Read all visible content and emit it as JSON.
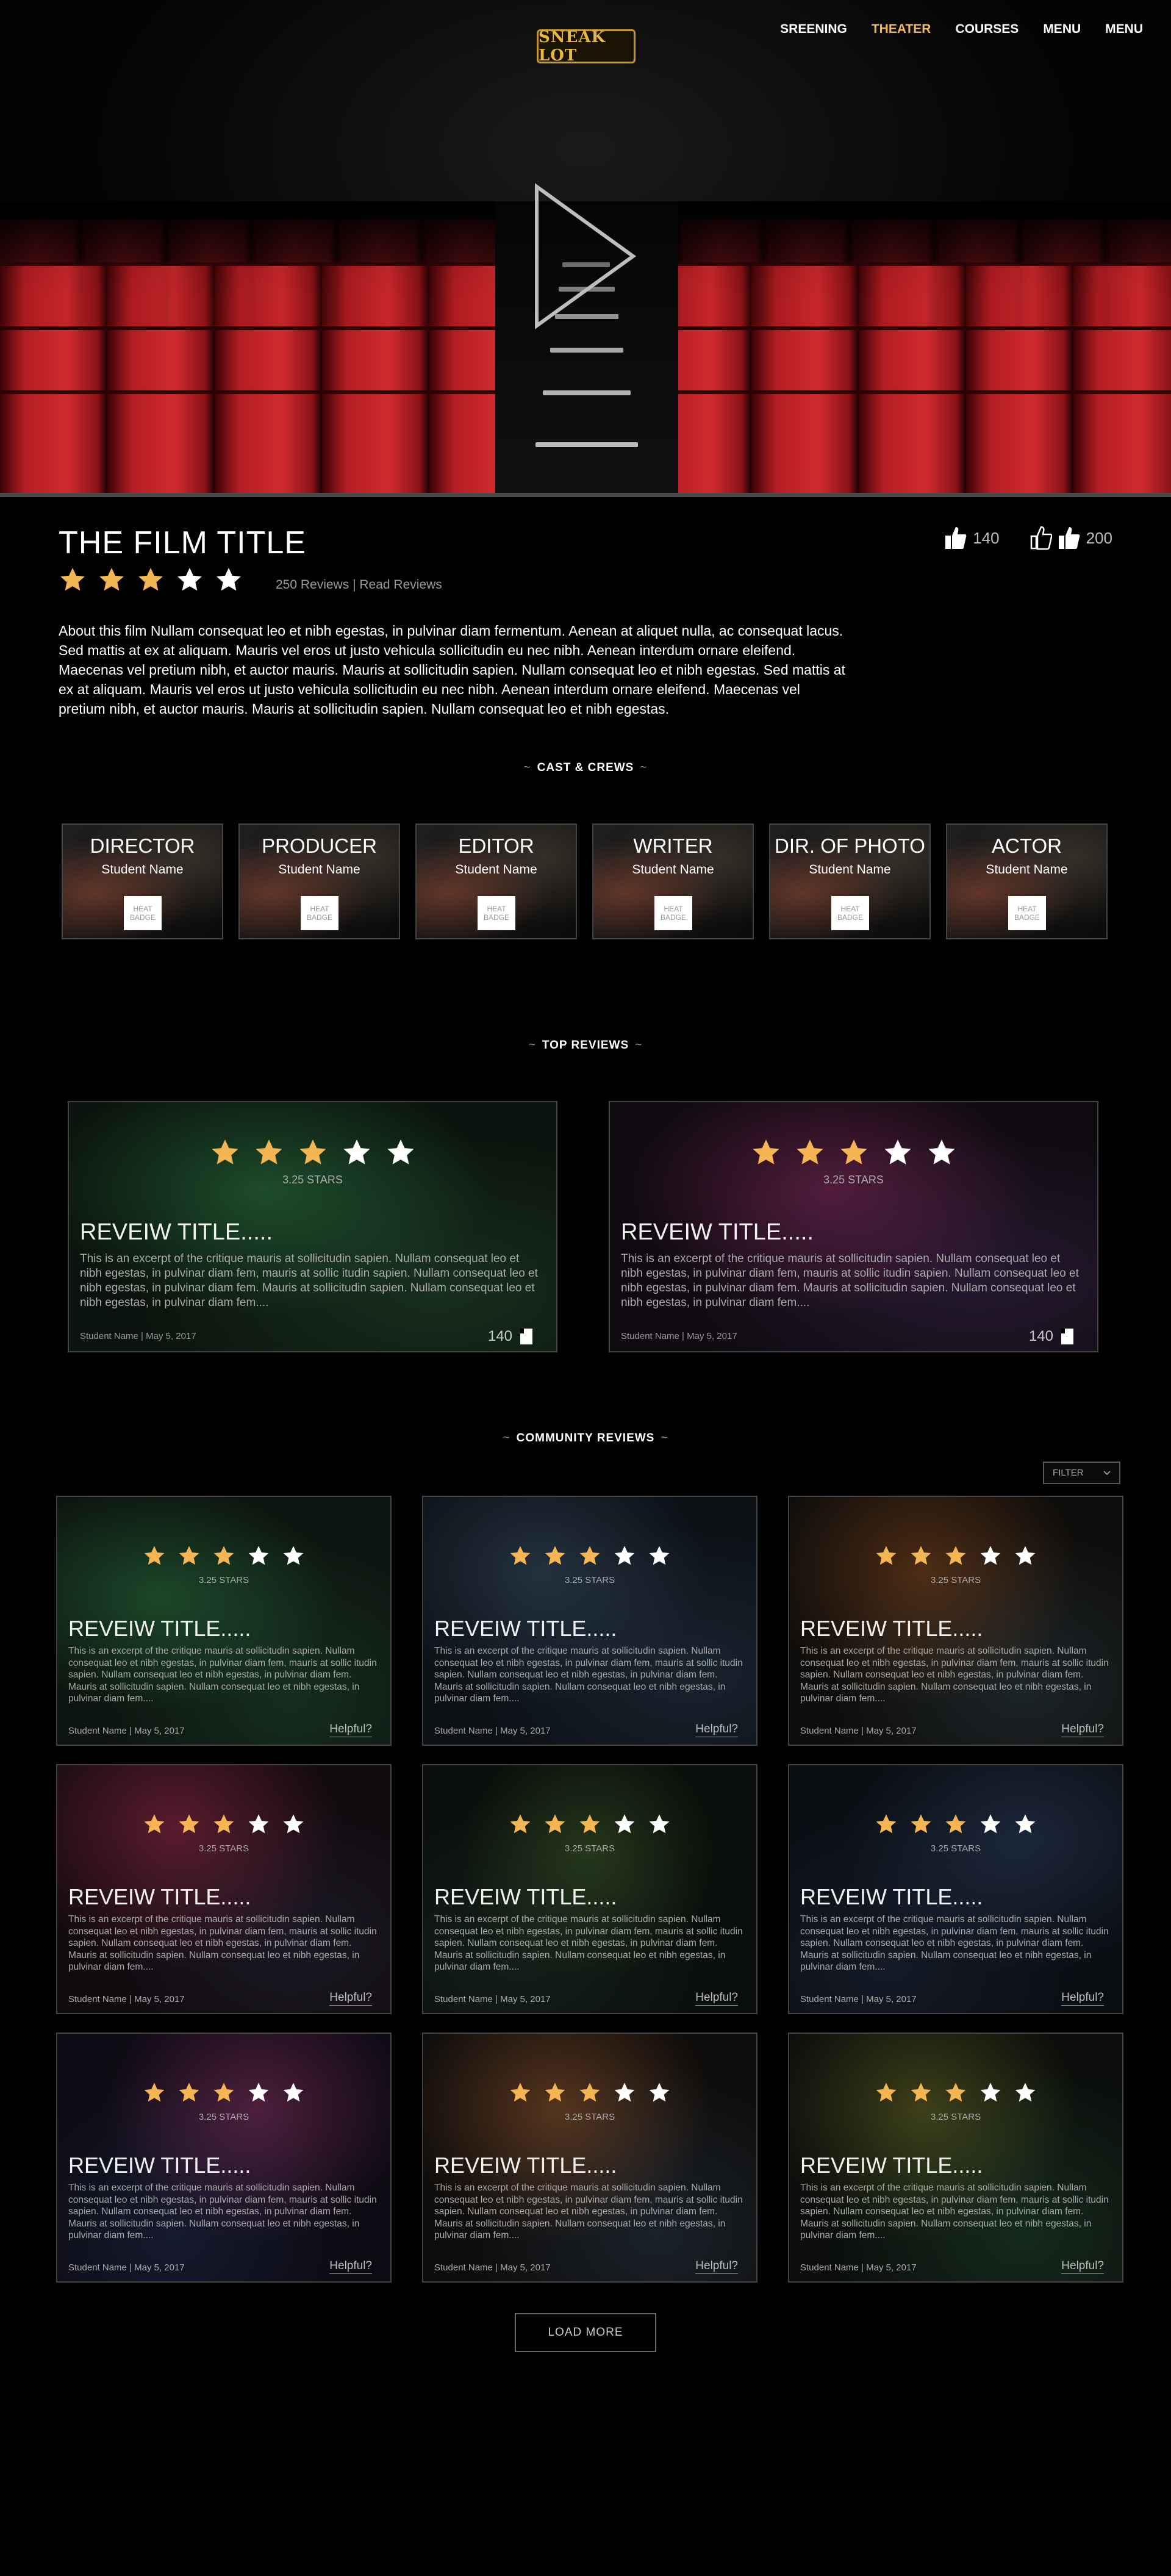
{
  "header": {
    "logo_text": "SNEAK LOT",
    "nav": [
      {
        "label": "SREENING",
        "active": false
      },
      {
        "label": "THEATER",
        "active": true
      },
      {
        "label": "COURSES",
        "active": false
      },
      {
        "label": "MENU",
        "active": false
      },
      {
        "label": "MENU",
        "active": false
      }
    ]
  },
  "hero": {
    "play_icon": "play-icon"
  },
  "film": {
    "title": "THE FILM TITLE",
    "rating": 3,
    "max_rating": 5,
    "reviews_link": "250 Reviews",
    "separator": "|",
    "read_reviews_link": "Read Reviews",
    "likes": "140",
    "dislikes": "200",
    "about": "About this film Nullam consequat leo et nibh egestas, in pulvinar diam fermentum. Aenean at aliquet nulla, ac consequat lacus. Sed mattis at ex at aliquam. Mauris vel eros ut justo vehicula sollicitudin eu nec nibh. Aenean interdum ornare eleifend. Maecenas vel pretium nibh, et auctor mauris. Mauris at sollicitudin sapien. Nullam consequat leo et nibh egestas. Sed mattis at ex at aliquam. Mauris vel eros ut justo vehicula sollicitudin eu nec nibh. Aenean interdum ornare eleifend. Maecenas vel pretium nibh, et auctor mauris. Mauris at sollicitudin sapien. Nullam consequat leo et nibh egestas."
  },
  "sections": {
    "cast": "CAST & CREWS",
    "top_reviews": "TOP  REVIEWS",
    "community_reviews": "COMMUNITY REVIEWS",
    "tilde": "~"
  },
  "cast": [
    {
      "role": "DIRECTOR",
      "name": "Student Name",
      "badge": "HEAT BADGE"
    },
    {
      "role": "PRODUCER",
      "name": "Student Name",
      "badge": "HEAT BADGE"
    },
    {
      "role": "EDITOR",
      "name": "Student Name",
      "badge": "HEAT BADGE"
    },
    {
      "role": "WRITER",
      "name": "Student Name",
      "badge": "HEAT BADGE"
    },
    {
      "role": "DIR. OF PHOTO",
      "name": "Student Name",
      "badge": "HEAT BADGE"
    },
    {
      "role": "ACTOR",
      "name": "Student Name",
      "badge": "HEAT BADGE"
    }
  ],
  "top_reviews": [
    {
      "rating": 3,
      "stars_label": "3.25 STARS",
      "title": "REVEIW TITLE.....",
      "excerpt": "This is an excerpt of the critique mauris at sollicitudin sapien. Nullam consequat leo et nibh egestas, in pulvinar diam fem, mauris at sollic itudin sapien. Nullam consequat leo et nibh egestas, in pulvinar diam fem. Mauris at sollicitudin sapien. Nullam consequat leo et nibh egestas, in pulvinar diam fem....",
      "meta": "Student Name | May 5, 2017",
      "count": "140"
    },
    {
      "rating": 3,
      "stars_label": "3.25 STARS",
      "title": "REVEIW TITLE.....",
      "excerpt": "This is an excerpt of the critique mauris at sollicitudin sapien. Nullam consequat leo et nibh egestas, in pulvinar diam fem, mauris at sollic itudin sapien. Nullam consequat leo et nibh egestas, in pulvinar diam fem. Mauris at sollicitudin sapien. Nullam consequat leo et nibh egestas, in pulvinar diam fem....",
      "meta": "Student Name | May 5, 2017",
      "count": "140"
    }
  ],
  "community": {
    "filter_label": "FILTER",
    "load_more": "LOAD MORE",
    "reviews": [
      {
        "rating": 3,
        "stars_label": "3.25 STARS",
        "title": "REVEIW TITLE.....",
        "excerpt": "This is an excerpt of the critique mauris at sollicitudin sapien. Nullam consequat leo et nibh egestas, in pulvinar diam fem, mauris at sollic itudin sapien. Nullam consequat leo et nibh egestas, in pulvinar diam fem. Mauris at sollicitudin sapien. Nullam consequat leo et nibh egestas, in pulvinar diam fem....",
        "meta": "Student Name | May 5, 2017",
        "helpful": "Helpful?"
      },
      {
        "rating": 3,
        "stars_label": "3.25 STARS",
        "title": "REVEIW TITLE.....",
        "excerpt": "This is an excerpt of the critique mauris at sollicitudin sapien. Nullam consequat leo et nibh egestas, in pulvinar diam fem, mauris at sollic itudin sapien. Nullam consequat leo et nibh egestas, in pulvinar diam fem. Mauris at sollicitudin sapien. Nullam consequat leo et nibh egestas, in pulvinar diam fem....",
        "meta": "Student Name | May 5, 2017",
        "helpful": "Helpful?"
      },
      {
        "rating": 3,
        "stars_label": "3.25 STARS",
        "title": "REVEIW TITLE.....",
        "excerpt": "This is an excerpt of the critique mauris at sollicitudin sapien. Nullam consequat leo et nibh egestas, in pulvinar diam fem, mauris at sollic itudin sapien. Nullam consequat leo et nibh egestas, in pulvinar diam fem. Mauris at sollicitudin sapien. Nullam consequat leo et nibh egestas, in pulvinar diam fem....",
        "meta": "Student Name | May 5, 2017",
        "helpful": "Helpful?"
      },
      {
        "rating": 3,
        "stars_label": "3.25 STARS",
        "title": "REVEIW TITLE.....",
        "excerpt": "This is an excerpt of the critique mauris at sollicitudin sapien. Nullam consequat leo et nibh egestas, in pulvinar diam fem, mauris at sollic itudin sapien. Nullam consequat leo et nibh egestas, in pulvinar diam fem. Mauris at sollicitudin sapien. Nullam consequat leo et nibh egestas, in pulvinar diam fem....",
        "meta": "Student Name | May 5, 2017",
        "helpful": "Helpful?"
      },
      {
        "rating": 3,
        "stars_label": "3.25 STARS",
        "title": "REVEIW TITLE.....",
        "excerpt": "This is an excerpt of the critique mauris at sollicitudin sapien. Nullam consequat leo et nibh egestas, in pulvinar diam fem, mauris at sollic itudin sapien. Nullam consequat leo et nibh egestas, in pulvinar diam fem. Mauris at sollicitudin sapien. Nullam consequat leo et nibh egestas, in pulvinar diam fem....",
        "meta": "Student Name | May 5, 2017",
        "helpful": "Helpful?"
      },
      {
        "rating": 3,
        "stars_label": "3.25 STARS",
        "title": "REVEIW TITLE.....",
        "excerpt": "This is an excerpt of the critique mauris at sollicitudin sapien. Nullam consequat leo et nibh egestas, in pulvinar diam fem, mauris at sollic itudin sapien. Nullam consequat leo et nibh egestas, in pulvinar diam fem. Mauris at sollicitudin sapien. Nullam consequat leo et nibh egestas, in pulvinar diam fem....",
        "meta": "Student Name | May 5, 2017",
        "helpful": "Helpful?"
      },
      {
        "rating": 3,
        "stars_label": "3.25 STARS",
        "title": "REVEIW TITLE.....",
        "excerpt": "This is an excerpt of the critique mauris at sollicitudin sapien. Nullam consequat leo et nibh egestas, in pulvinar diam fem, mauris at sollic itudin sapien. Nullam consequat leo et nibh egestas, in pulvinar diam fem. Mauris at sollicitudin sapien. Nullam consequat leo et nibh egestas, in pulvinar diam fem....",
        "meta": "Student Name | May 5, 2017",
        "helpful": "Helpful?"
      },
      {
        "rating": 3,
        "stars_label": "3.25 STARS",
        "title": "REVEIW TITLE.....",
        "excerpt": "This is an excerpt of the critique mauris at sollicitudin sapien. Nullam consequat leo et nibh egestas, in pulvinar diam fem, mauris at sollic itudin sapien. Nullam consequat leo et nibh egestas, in pulvinar diam fem. Mauris at sollicitudin sapien. Nullam consequat leo et nibh egestas, in pulvinar diam fem....",
        "meta": "Student Name | May 5, 2017",
        "helpful": "Helpful?"
      },
      {
        "rating": 3,
        "stars_label": "3.25 STARS",
        "title": "REVEIW TITLE.....",
        "excerpt": "This is an excerpt of the critique mauris at sollicitudin sapien. Nullam consequat leo et nibh egestas, in pulvinar diam fem, mauris at sollic itudin sapien. Nullam consequat leo et nibh egestas, in pulvinar diam fem. Mauris at sollicitudin sapien. Nullam consequat leo et nibh egestas, in pulvinar diam fem....",
        "meta": "Student Name | May 5, 2017",
        "helpful": "Helpful?"
      }
    ]
  },
  "colors": {
    "accent": "#f0b85a",
    "star_filled": "#f5b553",
    "star_empty": "#ffffff",
    "seat_red": "#b21d22",
    "logo_gold": "#c7972b"
  }
}
